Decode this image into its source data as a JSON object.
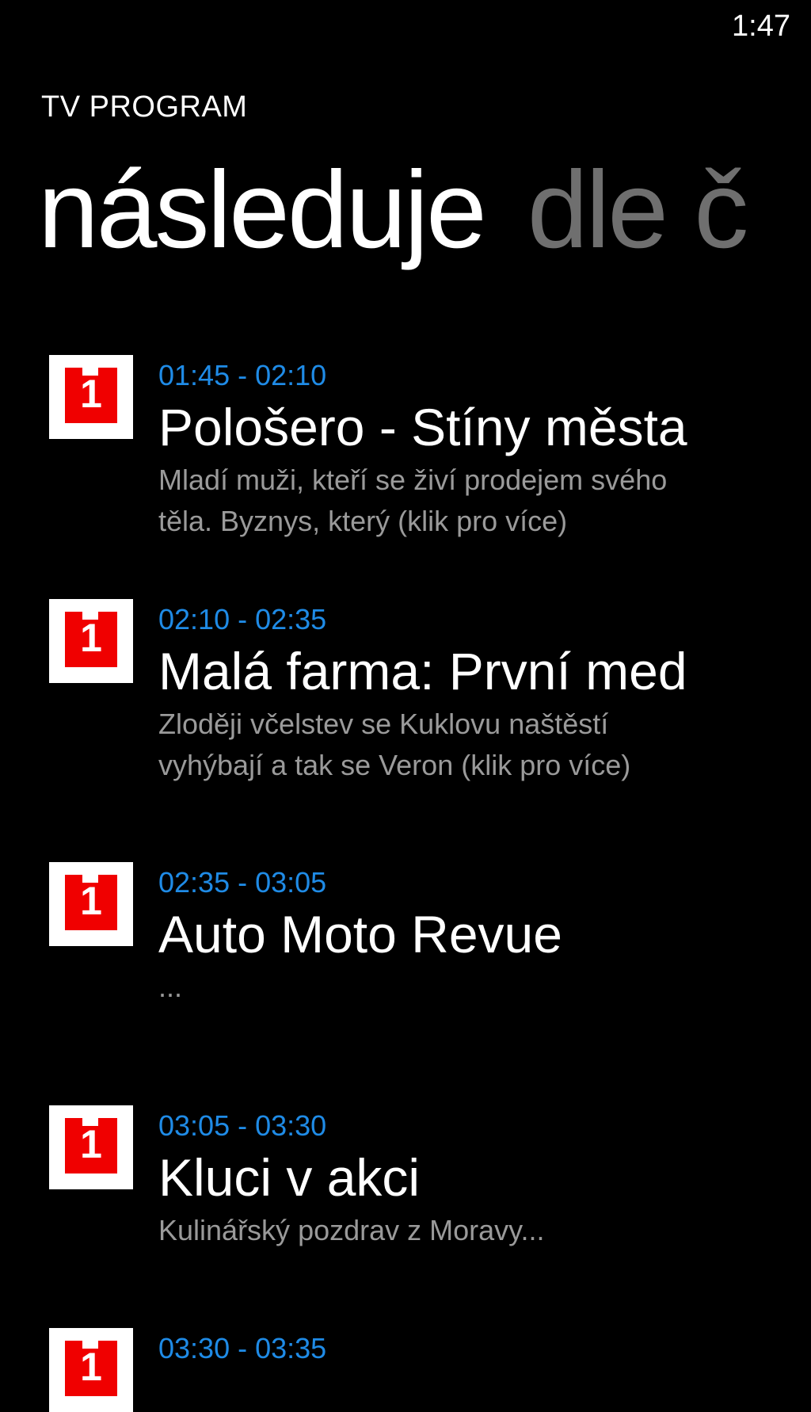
{
  "status_bar": {
    "time": "1:47"
  },
  "app": {
    "title": "TV PROGRAM"
  },
  "pivot": {
    "active": "následuje",
    "inactive": "dle č"
  },
  "channel_logo_digit": "1",
  "colors": {
    "accent": "#1f8be6",
    "logo_red": "#f00000",
    "secondary_text": "#9a9a9a",
    "inactive_pivot": "#6f6f6f"
  },
  "programs": [
    {
      "time": "01:45 - 02:10",
      "title": "Pološero - Stíny města",
      "desc_line1": "Mladí muži, kteří se živí prodejem svého",
      "desc_line2": "těla. Byznys, který (klik pro více)"
    },
    {
      "time": "02:10 - 02:35",
      "title": "Malá farma: První med",
      "desc_line1": "Zloději včelstev se Kuklovu naštěstí",
      "desc_line2": "vyhýbají a tak se Veron (klik pro více)"
    },
    {
      "time": "02:35 - 03:05",
      "title": "Auto Moto Revue",
      "desc_line1": "...",
      "desc_line2": ""
    },
    {
      "time": "03:05 - 03:30",
      "title": "Kluci v akci",
      "desc_line1": "Kulinářský pozdrav z Moravy...",
      "desc_line2": ""
    },
    {
      "time": "03:30 - 03:35",
      "title": "",
      "desc_line1": "",
      "desc_line2": ""
    }
  ]
}
